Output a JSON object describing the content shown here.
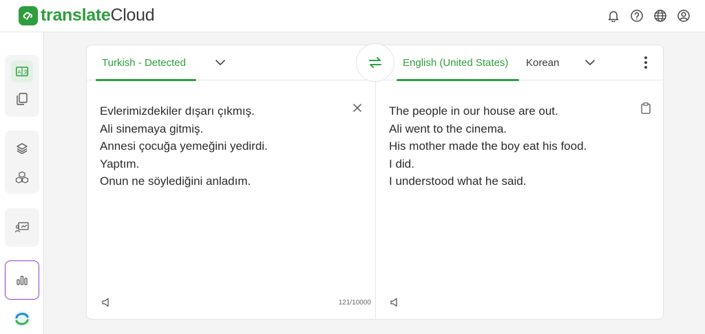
{
  "app": {
    "logo_bold": "translate",
    "logo_light": "Cloud",
    "accent": "#2e9e3e",
    "selected_outline": "#8a3fd1"
  },
  "header": {
    "icons": [
      "bell-icon",
      "help-icon",
      "globe-icon",
      "account-icon"
    ]
  },
  "sidebar": {
    "items": [
      {
        "icon": "translate-text-icon",
        "active": true
      },
      {
        "icon": "documents-icon",
        "active": false
      },
      {
        "icon": "layers-icon",
        "active": false
      },
      {
        "icon": "cubes-icon",
        "active": false
      },
      {
        "icon": "presentation-icon",
        "active": false
      },
      {
        "icon": "bar-chart-icon",
        "active": false,
        "selected": true
      },
      {
        "icon": "app-logo-icon",
        "active": false
      }
    ]
  },
  "source": {
    "tab_label": "Turkish - Detected",
    "lines": [
      "Evlerimizdekiler dışarı çıkmış.",
      "Ali sinemaya gitmiş.",
      "Annesi çocuğa yemeğini yedirdi.",
      "Yaptım.",
      "Onun ne söylediğini anladım."
    ],
    "char_count": "121/10000"
  },
  "target": {
    "tab_active_label": "English (United States)",
    "tab_other_label": "Korean",
    "lines": [
      "The people in our house are out.",
      "Ali went to the cinema.",
      "His mother made the boy eat his food.",
      "I did.",
      "I understood what he said."
    ]
  }
}
